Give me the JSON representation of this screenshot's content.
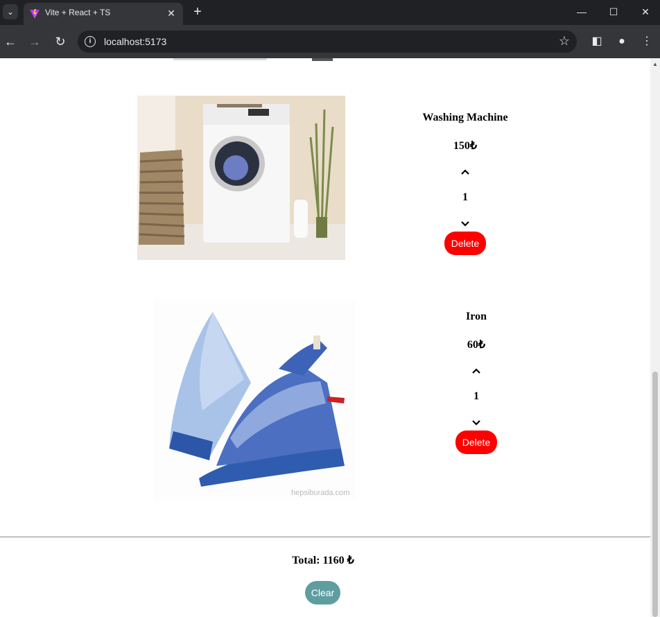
{
  "browser": {
    "tab_title": "Vite + React + TS",
    "url": "localhost:5173"
  },
  "cart": {
    "items": [
      {
        "name": "Washing Machine",
        "price": "150₺",
        "quantity": "1",
        "delete_label": "Delete"
      },
      {
        "name": "Iron",
        "price": "60₺",
        "quantity": "1",
        "delete_label": "Delete"
      }
    ],
    "total_label": "Total: 1160 ₺",
    "clear_label": "Clear",
    "image_watermark": "hepsiburada.com"
  },
  "colors": {
    "delete": "#ff0000",
    "clear": "#5f9ea0"
  }
}
